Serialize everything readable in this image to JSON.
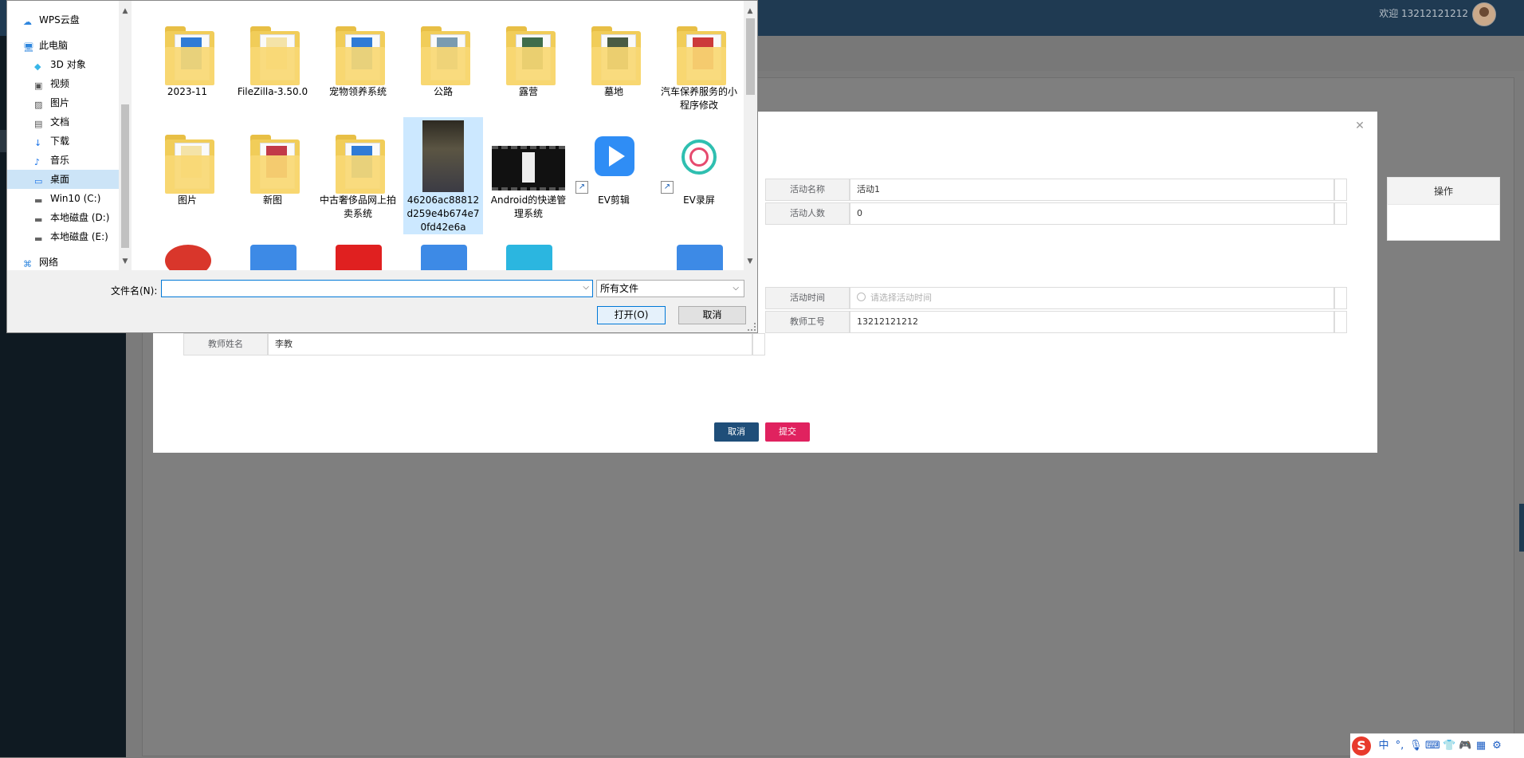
{
  "app": {
    "welcome_text": "欢迎 13212121212",
    "table_header_action": "操作"
  },
  "form": {
    "activity_name_label": "活动名称",
    "activity_name_value": "活动1",
    "activity_count_label": "活动人数",
    "activity_count_value": "0",
    "activity_time_label": "活动时间",
    "activity_time_placeholder": "请选择活动时间",
    "teacher_id_label": "教师工号",
    "teacher_id_value": "13212121212",
    "teacher_name_label": "教师姓名",
    "teacher_name_value": "李教",
    "cancel_label": "取消",
    "submit_label": "提交"
  },
  "file_dialog": {
    "tree": [
      {
        "label": "WPS云盘",
        "icon": "cloud-icon"
      },
      {
        "label": "此电脑",
        "icon": "computer-icon"
      },
      {
        "label": "3D 对象",
        "icon": "cube-icon"
      },
      {
        "label": "视频",
        "icon": "video-icon"
      },
      {
        "label": "图片",
        "icon": "picture-icon"
      },
      {
        "label": "文档",
        "icon": "document-icon"
      },
      {
        "label": "下载",
        "icon": "download-icon"
      },
      {
        "label": "音乐",
        "icon": "music-icon"
      },
      {
        "label": "桌面",
        "icon": "desktop-icon",
        "selected": true
      },
      {
        "label": "Win10 (C:)",
        "icon": "drive-icon"
      },
      {
        "label": "本地磁盘 (D:)",
        "icon": "drive-icon"
      },
      {
        "label": "本地磁盘 (E:)",
        "icon": "drive-icon"
      },
      {
        "label": "网络",
        "icon": "network-icon"
      }
    ],
    "files": [
      {
        "name": "2023-11",
        "kind": "folder",
        "art": "#2f7bd6"
      },
      {
        "name": "FileZilla-3.50.0",
        "kind": "folder",
        "art": "#f4e3a8"
      },
      {
        "name": "宠物领养系统",
        "kind": "folder",
        "art": "#2f7bd6"
      },
      {
        "name": "公路",
        "kind": "folder",
        "art": "#7a9bb0"
      },
      {
        "name": "露营",
        "kind": "folder",
        "art": "#3f6d4b"
      },
      {
        "name": "墓地",
        "kind": "folder",
        "art": "#4a5c44"
      },
      {
        "name": "汽车保养服务的小程序修改",
        "kind": "folder",
        "art": "#cc3a3a"
      },
      {
        "name": "图片",
        "kind": "folder",
        "art": "#f4e3a8"
      },
      {
        "name": "新图",
        "kind": "folder",
        "art": "#c23a48"
      },
      {
        "name": "中古奢侈品网上拍卖系统",
        "kind": "folder",
        "art": "#2f7bd6"
      },
      {
        "name": "46206ac88812d259e4b674e70fd42e6a",
        "kind": "photo",
        "selected": true
      },
      {
        "name": "Android的快递管理系统",
        "kind": "video"
      },
      {
        "name": "EV剪辑",
        "kind": "shortcut-play"
      },
      {
        "name": "EV录屏",
        "kind": "shortcut-ev"
      }
    ],
    "file_name_label": "文件名(N):",
    "file_name_value": "",
    "file_type_value": "所有文件",
    "open_label": "打开(O)",
    "cancel_label": "取消"
  },
  "ime": {
    "logo": "S",
    "items": [
      "中",
      "°,",
      "mic-icon",
      "keyboard-icon",
      "shirt-icon",
      "game-icon",
      "grid-icon",
      "settings-icon"
    ]
  }
}
